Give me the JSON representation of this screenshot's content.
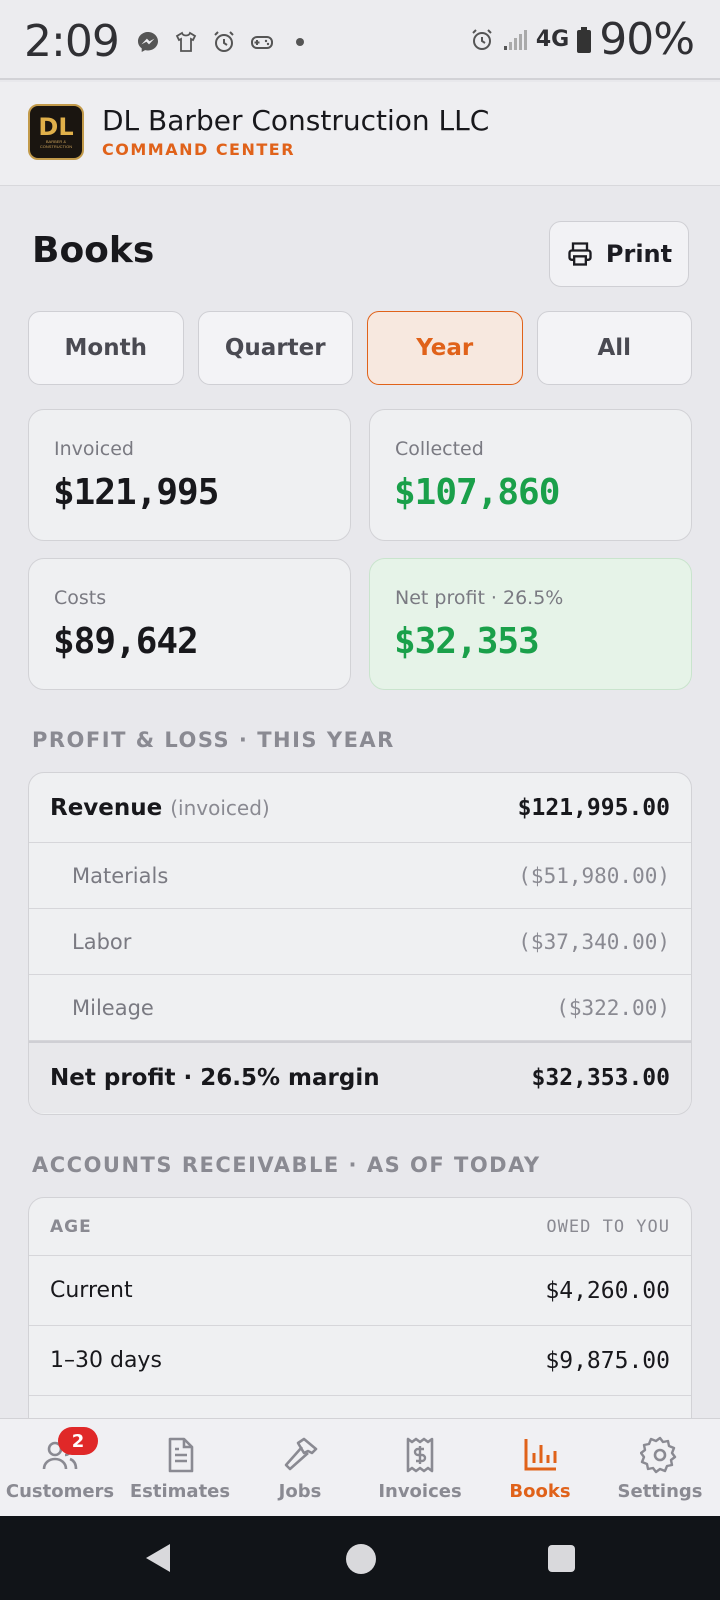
{
  "status_bar": {
    "time": "2:09",
    "network": "4G",
    "battery": "90%",
    "left_icons": [
      "messenger-icon",
      "shirt-icon",
      "alarm-icon",
      "gamepad-icon",
      "dot-icon"
    ],
    "right_icons": [
      "alarm-icon",
      "signal-icon",
      "4g-lte-icon",
      "battery-icon"
    ]
  },
  "header": {
    "logo_text": "DL",
    "logo_subtext": "BARBER & CONSTRUCTION",
    "company_name": "DL Barber Construction LLC",
    "subtitle": "COMMAND CENTER"
  },
  "page": {
    "title": "Books",
    "print_label": "Print"
  },
  "period_tabs": [
    {
      "label": "Month",
      "active": false
    },
    {
      "label": "Quarter",
      "active": false
    },
    {
      "label": "Year",
      "active": true
    },
    {
      "label": "All",
      "active": false
    }
  ],
  "stats": {
    "invoiced": {
      "label": "Invoiced",
      "value": "$121,995"
    },
    "collected": {
      "label": "Collected",
      "value": "$107,860"
    },
    "costs": {
      "label": "Costs",
      "value": "$89,642"
    },
    "net_profit": {
      "label": "Net profit · 26.5%",
      "value": "$32,353"
    }
  },
  "pl": {
    "section_title": "PROFIT & LOSS · THIS YEAR",
    "revenue_label": "Revenue",
    "revenue_note": "(invoiced)",
    "revenue_amount": "$121,995.00",
    "lines": [
      {
        "label": "Materials",
        "amount": "($51,980.00)"
      },
      {
        "label": "Labor",
        "amount": "($37,340.00)"
      },
      {
        "label": "Mileage",
        "amount": "($322.00)"
      }
    ],
    "total_label": "Net profit · 26.5% margin",
    "total_amount": "$32,353.00"
  },
  "ar": {
    "section_title": "ACCOUNTS RECEIVABLE · AS OF TODAY",
    "col_age": "AGE",
    "col_owed": "OWED TO YOU",
    "rows": [
      {
        "label": "Current",
        "amount": "$4,260.00"
      },
      {
        "label": "1–30 days",
        "amount": "$9,875.00"
      }
    ]
  },
  "nav": {
    "items": [
      {
        "label": "Customers",
        "icon": "users-icon",
        "badge": "2"
      },
      {
        "label": "Estimates",
        "icon": "document-icon"
      },
      {
        "label": "Jobs",
        "icon": "hammer-icon"
      },
      {
        "label": "Invoices",
        "icon": "receipt-icon"
      },
      {
        "label": "Books",
        "icon": "bar-chart-icon",
        "active": true
      },
      {
        "label": "Settings",
        "icon": "gear-icon"
      }
    ]
  },
  "colors": {
    "accent": "#e0621a",
    "positive": "#1aa04a",
    "badge": "#e02828"
  }
}
